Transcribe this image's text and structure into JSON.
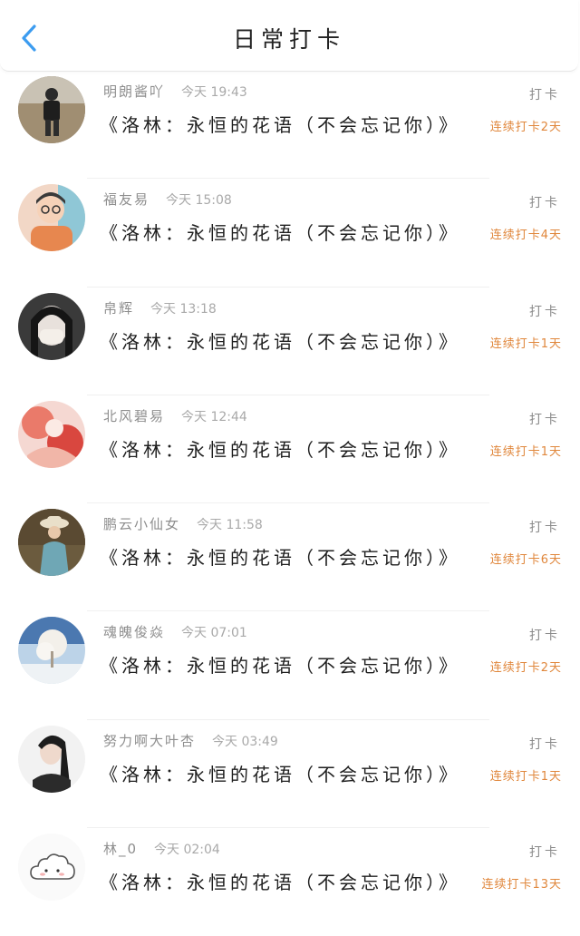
{
  "header": {
    "title": "日常打卡",
    "back_icon": "chevron-left-icon",
    "accent_color": "#3c9cf0"
  },
  "list": {
    "items": [
      {
        "name": "明朗酱吖",
        "time": "今天 19:43",
        "action": "打卡",
        "text": "《洛林：永恒的花语（不会忘记你）》",
        "streak": "连续打卡2天",
        "avatar": "avatar-photo"
      },
      {
        "name": "福友易",
        "time": "今天 15:08",
        "action": "打卡",
        "text": "《洛林：永恒的花语（不会忘记你）》",
        "streak": "连续打卡4天",
        "avatar": "avatar-photo"
      },
      {
        "name": "帛辉",
        "time": "今天 13:18",
        "action": "打卡",
        "text": "《洛林：永恒的花语（不会忘记你）》",
        "streak": "连续打卡1天",
        "avatar": "avatar-photo"
      },
      {
        "name": "北风碧易",
        "time": "今天 12:44",
        "action": "打卡",
        "text": "《洛林：永恒的花语（不会忘记你）》",
        "streak": "连续打卡1天",
        "avatar": "avatar-photo"
      },
      {
        "name": "鹏云小仙女",
        "time": "今天 11:58",
        "action": "打卡",
        "text": "《洛林：永恒的花语（不会忘记你）》",
        "streak": "连续打卡6天",
        "avatar": "avatar-photo"
      },
      {
        "name": "魂魄俊焱",
        "time": "今天 07:01",
        "action": "打卡",
        "text": "《洛林：永恒的花语（不会忘记你）》",
        "streak": "连续打卡2天",
        "avatar": "avatar-photo"
      },
      {
        "name": "努力啊大叶杏",
        "time": "今天 03:49",
        "action": "打卡",
        "text": "《洛林：永恒的花语（不会忘记你）》",
        "streak": "连续打卡1天",
        "avatar": "avatar-photo"
      },
      {
        "name": "林_0",
        "time": "今天 02:04",
        "action": "打卡",
        "text": "《洛林：永恒的花语（不会忘记你）》",
        "streak": "连续打卡13天",
        "avatar": "cloud-avatar-icon"
      }
    ]
  },
  "colors": {
    "streak": "#e0873c",
    "name": "#8e8e8e",
    "text": "#1f1f1f"
  }
}
